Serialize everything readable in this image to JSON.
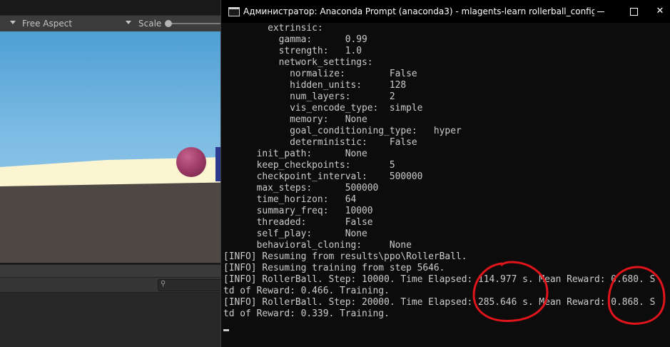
{
  "unity": {
    "aspect_label": "Free Aspect",
    "scale_label": "Scale",
    "search_icon": "search-icon"
  },
  "console": {
    "title": "Администратор: Anaconda Prompt (anaconda3) - mlagents-learn  rollerball_config.yaml",
    "controls": {
      "minimize": "—",
      "maximize": "□",
      "close": "✕"
    },
    "lines": [
      "        extrinsic:",
      "          gamma:      0.99",
      "          strength:   1.0",
      "          network_settings:",
      "            normalize:        False",
      "            hidden_units:     128",
      "            num_layers:       2",
      "            vis_encode_type:  simple",
      "            memory:   None",
      "            goal_conditioning_type:   hyper",
      "            deterministic:    False",
      "      init_path:      None",
      "      keep_checkpoints:       5",
      "      checkpoint_interval:    500000",
      "      max_steps:      500000",
      "      time_horizon:   64",
      "      summary_freq:   10000",
      "      threaded:       False",
      "      self_play:      None",
      "      behavioral_cloning:     None",
      "[INFO] Resuming from results\\ppo\\RollerBall.",
      "[INFO] Resuming training from step 5646.",
      "[INFO] RollerBall. Step: 10000. Time Elapsed: 114.977 s. Mean Reward: 0.680. S",
      "td of Reward: 0.466. Training.",
      "[INFO] RollerBall. Step: 20000. Time Elapsed: 285.646 s. Mean Reward: 0.868. S",
      "td of Reward: 0.339. Training."
    ]
  },
  "colors": {
    "console_bg": "#0c0c0c",
    "console_text": "#cccccc",
    "annotation": "#e0141b",
    "ball": "#a23e6a",
    "sky": "#7dbce4"
  }
}
